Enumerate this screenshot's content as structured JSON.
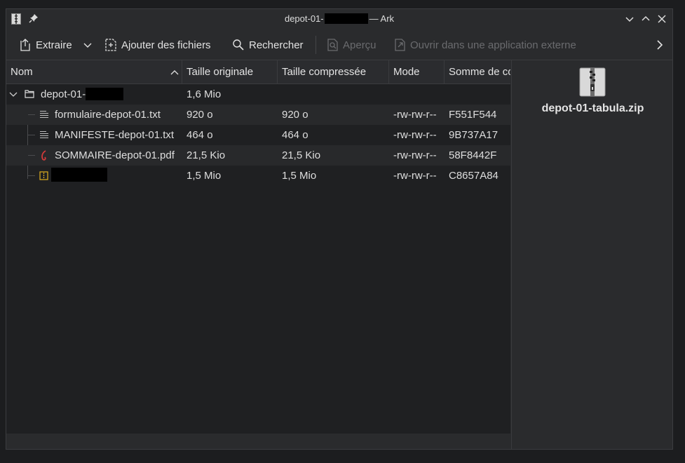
{
  "window": {
    "title_prefix": "depot-01-",
    "title_suffix": "— Ark"
  },
  "toolbar": {
    "extract_label": "Extraire",
    "add_files_label": "Ajouter des fichiers",
    "search_label": "Rechercher",
    "preview_label": "Aperçu",
    "open_external_label": "Ouvrir dans une application externe"
  },
  "columns": {
    "name": "Nom",
    "original_size": "Taille originale",
    "compressed_size": "Taille compressée",
    "mode": "Mode",
    "checksum": "Somme de co"
  },
  "tree": {
    "folder": {
      "name": "depot-01-",
      "original_size": "1,6 Mio"
    },
    "files": [
      {
        "name": "formulaire-depot-01.txt",
        "original_size": "920 o",
        "compressed_size": "920 o",
        "mode": "-rw-rw-r--",
        "checksum": "F551F544",
        "icon": "text-file-icon"
      },
      {
        "name": "MANIFESTE-depot-01.txt",
        "original_size": "464 o",
        "compressed_size": "464 o",
        "mode": "-rw-rw-r--",
        "checksum": "9B737A17",
        "icon": "text-file-icon"
      },
      {
        "name": "SOMMAIRE-depot-01.pdf",
        "original_size": "21,5 Kio",
        "compressed_size": "21,5 Kio",
        "mode": "-rw-rw-r--",
        "checksum": "58F8442F",
        "icon": "pdf-file-icon"
      },
      {
        "name": "",
        "original_size": "1,5 Mio",
        "compressed_size": "1,5 Mio",
        "mode": "-rw-rw-r--",
        "checksum": "C8657A84",
        "icon": "archive-file-icon"
      }
    ]
  },
  "side_panel": {
    "archive_name": "depot-01-tabula.zip"
  }
}
